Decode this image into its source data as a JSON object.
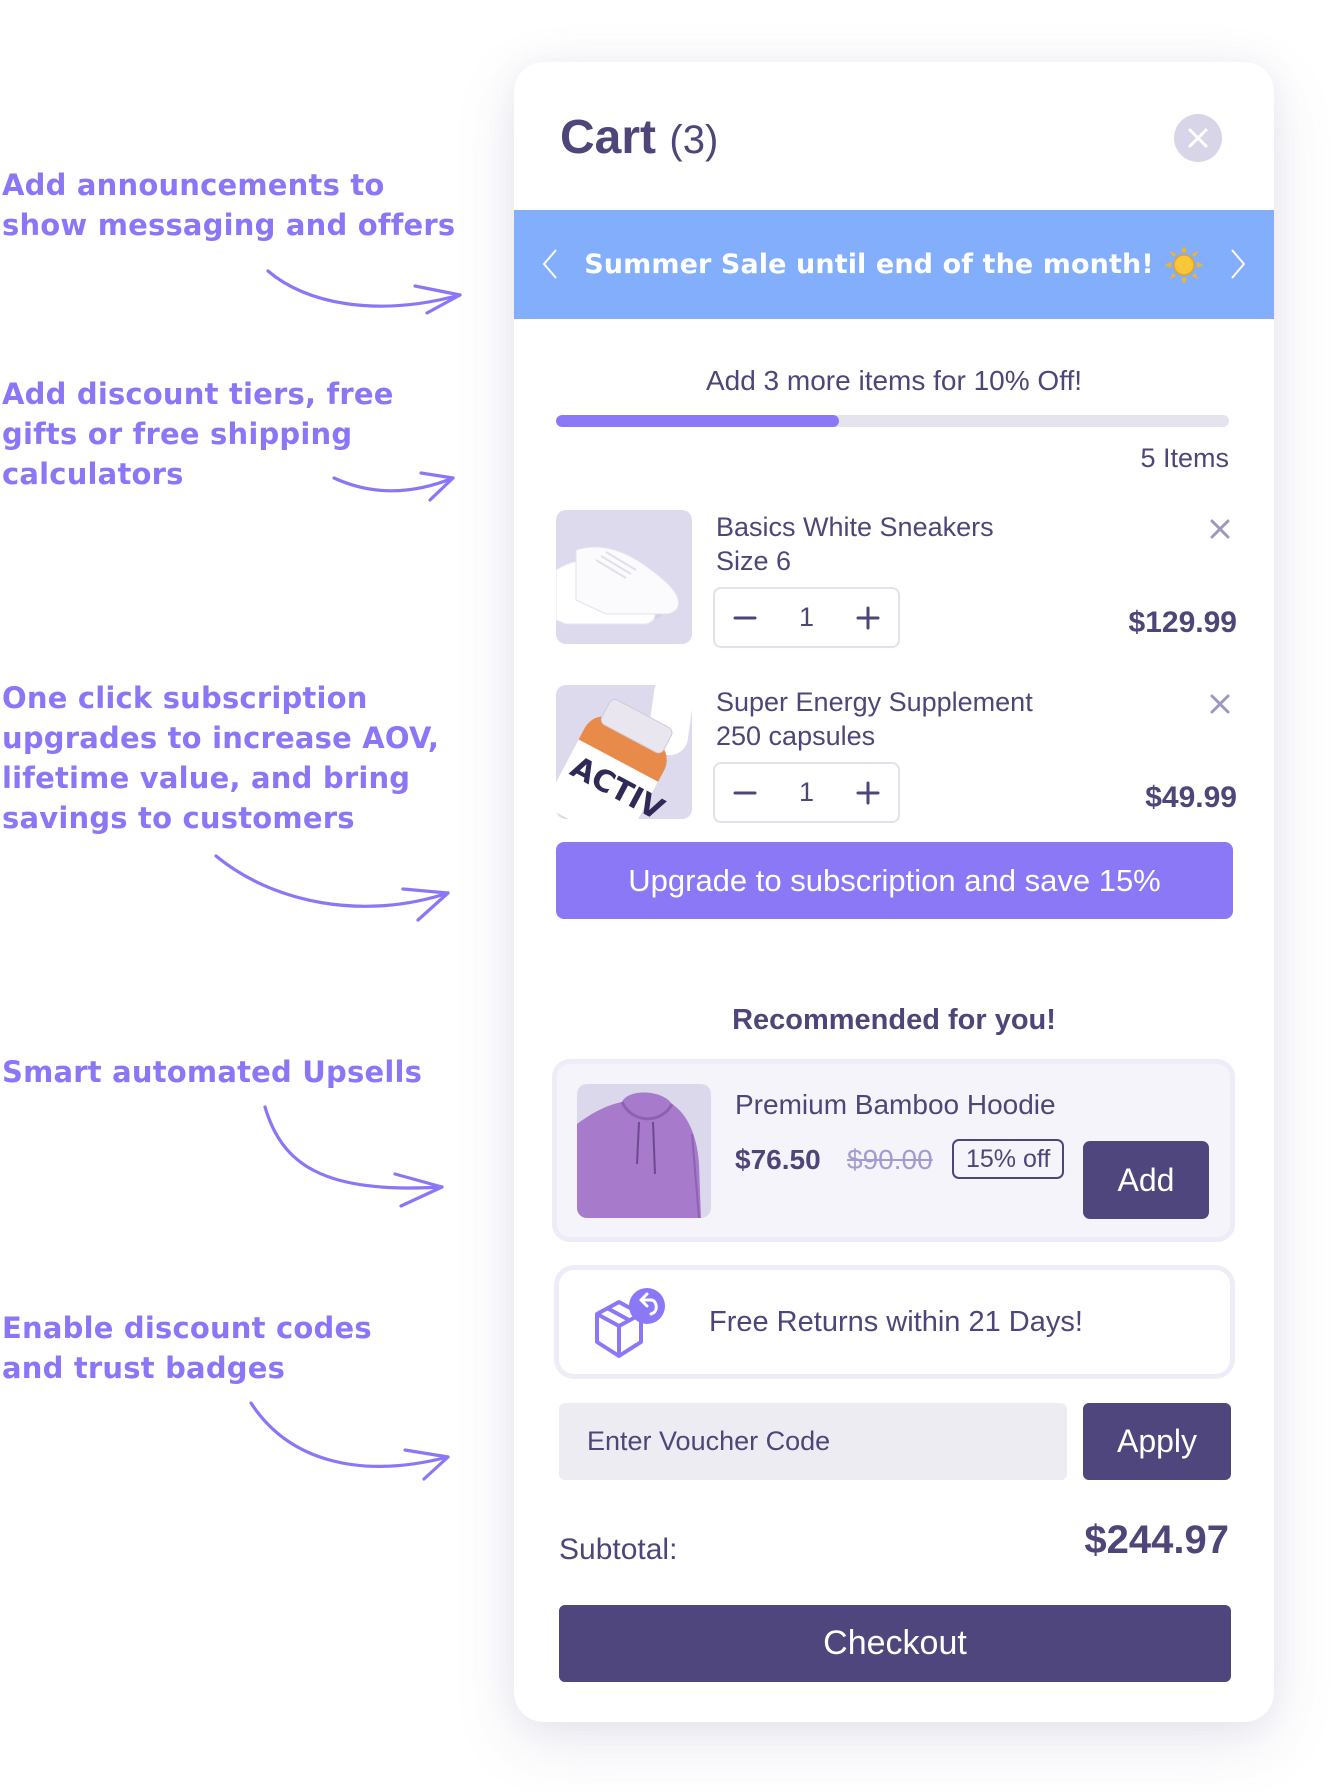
{
  "annotations": [
    {
      "text": "Add announcements to\nshow messaging and offers"
    },
    {
      "text": "Add discount tiers, free\ngifts or free shipping\ncalculators"
    },
    {
      "text": "One click subscription\nupgrades to increase AOV,\nlifetime value, and bring\nsavings to customers"
    },
    {
      "text": "Smart automated Upsells"
    },
    {
      "text": "Enable discount codes\nand trust badges"
    }
  ],
  "cart": {
    "title": "Cart",
    "count": "(3)",
    "close_icon": "close-icon"
  },
  "announcement": {
    "text": "Summer Sale until end of the month!",
    "emoji": "sun-icon",
    "background": "#82AEFC"
  },
  "tier": {
    "message": "Add 3 more items for 10% Off!",
    "progress_fraction": 0.42,
    "items_label": "5 Items"
  },
  "items": [
    {
      "name": "Basics White Sneakers",
      "variant": "Size 6",
      "quantity": "1",
      "price": "$129.99",
      "image": "white-sneakers"
    },
    {
      "name": "Super Energy Supplement",
      "variant": "250 capsules",
      "quantity": "1",
      "price": "$49.99",
      "image": "supplement-bottle"
    }
  ],
  "subscription": {
    "label": "Upgrade to subscription and save 15%"
  },
  "recommendations": {
    "title": "Recommended for you!",
    "product": {
      "name": "Premium Bamboo Hoodie",
      "price": "$76.50",
      "compare_price": "$90.00",
      "badge": "15% off",
      "add_label": "Add",
      "image": "purple-hoodie"
    }
  },
  "trust_badge": {
    "text": "Free Returns within 21 Days!",
    "icon": "box-return-icon"
  },
  "voucher": {
    "placeholder": "Enter Voucher Code",
    "value": "",
    "apply_label": "Apply"
  },
  "summary": {
    "subtotal_label": "Subtotal:",
    "subtotal_value": "$244.97"
  },
  "checkout": {
    "label": "Checkout"
  },
  "colors": {
    "primary_dark": "#4F467D",
    "accent": "#8B78F7",
    "annotation": "#8A76F7"
  }
}
